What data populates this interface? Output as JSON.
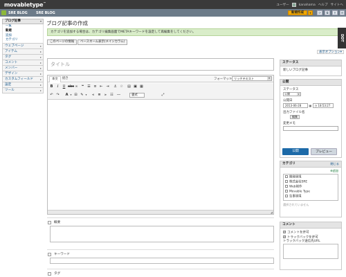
{
  "app": {
    "logo": "movabletype",
    "logo_mark": "™"
  },
  "topbar": {
    "user_label": "ユーザー",
    "username": "kanahama",
    "help": "ヘルプ",
    "site": "サイトへ"
  },
  "blogbar": {
    "sre_blog_1": "SRE BLOG",
    "sre_blog_2": "SRE BLOG",
    "new_button": "新規作成",
    "new_arrow": "▾"
  },
  "sidebar": {
    "blog_entries": "ブログ記事",
    "sub": [
      "一覧",
      "新規",
      "追加",
      "カテゴリ"
    ],
    "items": [
      "ウェブページ",
      "アイテム",
      "タグ",
      "コメント",
      "メンバー",
      "デザイン",
      "カスタムフィールド",
      "設定",
      "ツール"
    ]
  },
  "page": {
    "title": "ブログ記事の作成"
  },
  "notice": {
    "text": "カテゴリを追加する場合は、カテゴリ編集画面でMETAキーワードを設定して再編集をしてください。"
  },
  "tabs": [
    "このページの情報",
    "ベースネーム表示(メインカラム)"
  ],
  "display_options": "表示オプション▾",
  "editor": {
    "title_placeholder": "タイトル",
    "tab_body": "本文",
    "tab_more": "続き",
    "format_label": "フォーマット",
    "format_value": "リッチテキスト",
    "format_dd": "書式"
  },
  "fields": {
    "excerpt": "概要",
    "keywords": "キーワード",
    "tags": "タグ"
  },
  "status_widget": {
    "title": "ステータス",
    "value": "新しいブログ記事"
  },
  "publish_widget": {
    "title": "公開",
    "status_label": "ステータス",
    "status_value": "公開",
    "date_label": "公開日",
    "date_value": "2013-06-28",
    "time_value": "18:53:27",
    "filename_label": "出力ファイル名",
    "edit_button": "編集",
    "memo_label": "変更メモ",
    "publish_button": "公開",
    "preview_button": "プレビュー"
  },
  "category_widget": {
    "title": "カテゴリ",
    "close": "閉じる",
    "add": "追加",
    "items": [
      "開発環境",
      "株式会社SRE",
      "Web制作",
      "Movable Type",
      "告事環境"
    ],
    "none_selected": "選択されていません"
  },
  "comment_widget": {
    "title": "コメント",
    "allow_comments": "コメントを許可",
    "allow_trackbacks": "トラックバックを許可",
    "trackback_url_label": "トラックバック送信先URL"
  },
  "ddt": "DDT",
  "colors": {
    "accent": "#1d6aa8",
    "notice_bg": "#d9edc9",
    "new_button": "#f0a800",
    "blogbar": "#6c7b89",
    "topbar": "#3a3a3a"
  }
}
